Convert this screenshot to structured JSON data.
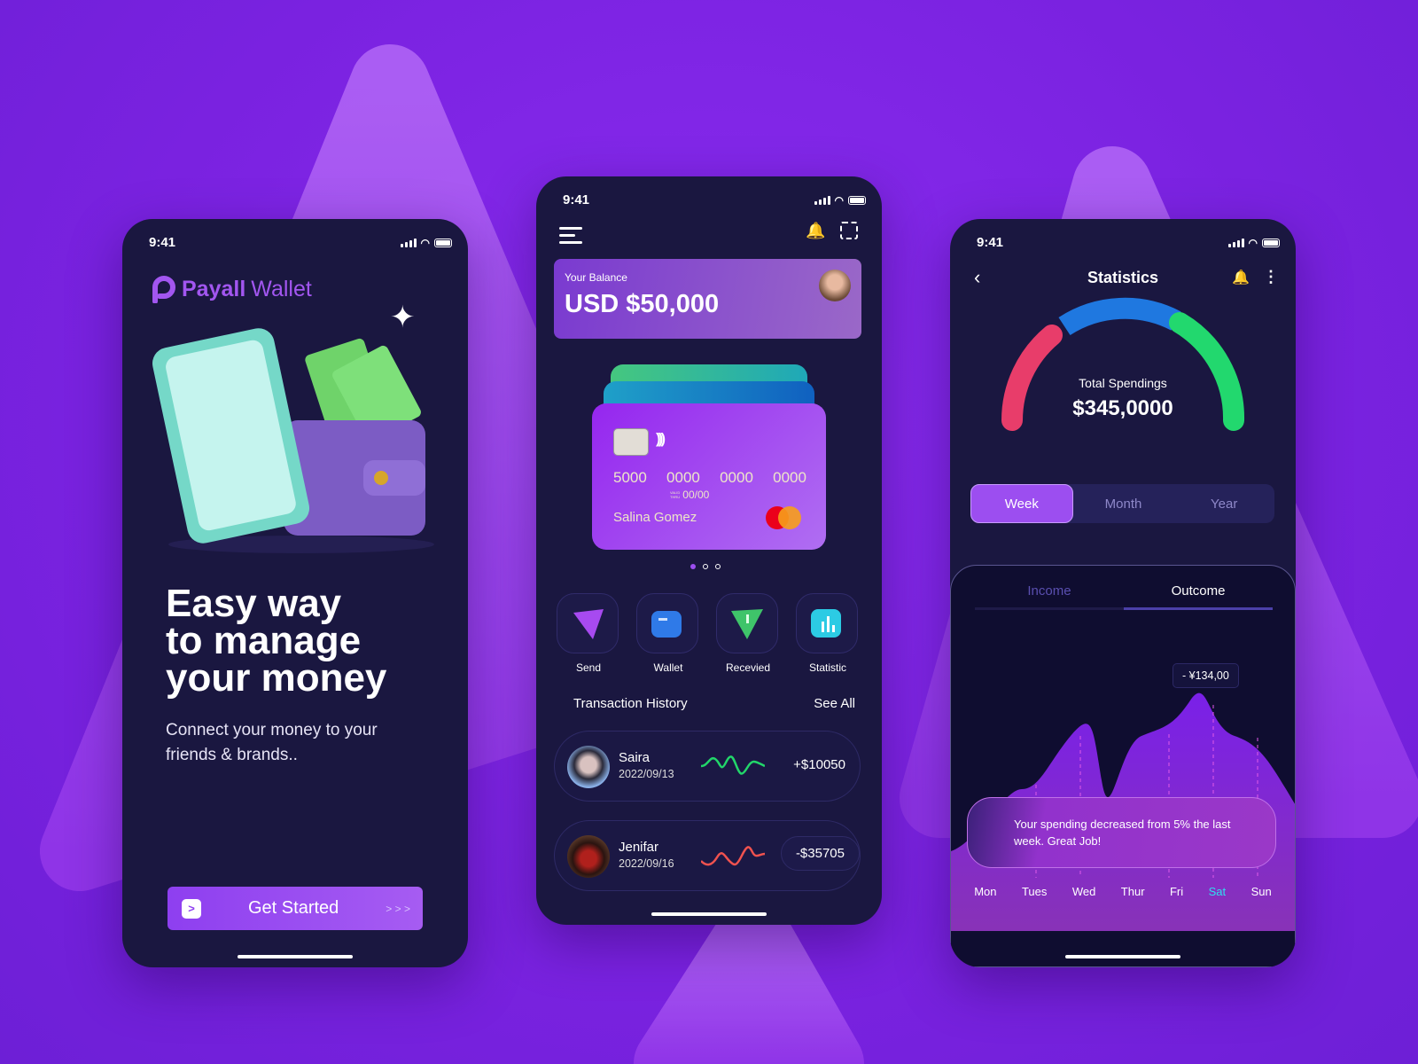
{
  "status_time": "9:41",
  "onboarding": {
    "brand_bold": "Payall",
    "brand_light": "Wallet",
    "headline": [
      "Easy way",
      "to manage",
      "your money"
    ],
    "subtitle": "Connect your money to your friends & brands..",
    "cta_label": "Get Started",
    "cta_arrows": "> > >"
  },
  "home": {
    "balance_label": "Your Balance",
    "balance": "USD $50,000",
    "card": {
      "number": [
        "5000",
        "0000",
        "0000",
        "0000"
      ],
      "valid_label_1": "VALID",
      "valid_label_2": "THRU",
      "expiry": "00/00",
      "holder": "Salina Gomez"
    },
    "carousel": {
      "count": 3,
      "active": 1
    },
    "actions": [
      {
        "label": "Send",
        "icon": "send-icon"
      },
      {
        "label": "Wallet",
        "icon": "wallet-icon"
      },
      {
        "label": "Recevied",
        "icon": "received-icon"
      },
      {
        "label": "Statistic",
        "icon": "statistic-icon"
      }
    ],
    "history_title": "Transaction History",
    "see_all": "See All",
    "transactions": [
      {
        "name": "Saira",
        "date": "2022/09/13",
        "amount": "+$10050",
        "trend_color": "#22d66a"
      },
      {
        "name": "Jenifar",
        "date": "2022/09/16",
        "amount": "-$35705",
        "trend_color": "#f0524f"
      }
    ]
  },
  "stats": {
    "title": "Statistics",
    "gauge": {
      "label": "Total Spendings",
      "value": "$345,0000",
      "colors": [
        "#e83d6a",
        "#1f78e0",
        "#22d86e"
      ]
    },
    "periods": [
      "Week",
      "Month",
      "Year"
    ],
    "active_period": "Week",
    "tabs": [
      "Income",
      "Outcome"
    ],
    "active_tab": "Outcome",
    "tooltip": "- ¥134,00",
    "message": "Your spending decreased from 5% the last week. Great Job!",
    "days": [
      "Mon",
      "Tues",
      "Wed",
      "Thur",
      "Fri",
      "Sat",
      "Sun"
    ],
    "active_day": "Sat",
    "accent": "#9c4ef0",
    "highlight": "#2ee0f0"
  }
}
